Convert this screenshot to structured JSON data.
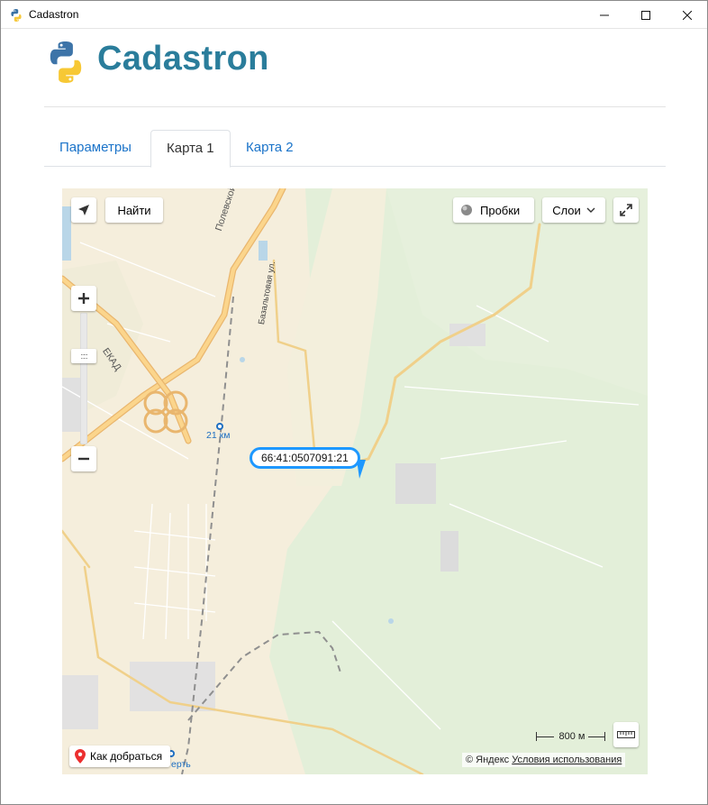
{
  "window": {
    "title": "Cadastron",
    "icons": {
      "app": "python-logo-icon",
      "minimize": "minimize-icon",
      "maximize": "maximize-icon",
      "close": "close-icon"
    }
  },
  "header": {
    "brand": "Cadastron",
    "logo_icon": "python-logo-icon",
    "colors": {
      "brand": "#2a7d9b",
      "link": "#1a73c9"
    }
  },
  "tabs": [
    {
      "label": "Параметры",
      "active": false
    },
    {
      "label": "Карта 1",
      "active": true
    },
    {
      "label": "Карта 2",
      "active": false
    }
  ],
  "map": {
    "controls": {
      "find_label": "Найти",
      "traffic_label": "Пробки",
      "layers_label": "Слои",
      "route_label": "Как добраться",
      "zoom_in": "+",
      "zoom_out": "−"
    },
    "scale_label": "800 м",
    "copyright_owner": "© Яндекс",
    "terms_link": "Условия использования",
    "placemark_label": "66:41:0507091:21",
    "map_labels": {
      "road_polevskoy": "Полевской тракт",
      "road_ekad": "ЕКАД",
      "street_bazaltovaya": "Базальтовая ул.",
      "station_21km": "21 км",
      "station_bottom": "ерть"
    }
  }
}
